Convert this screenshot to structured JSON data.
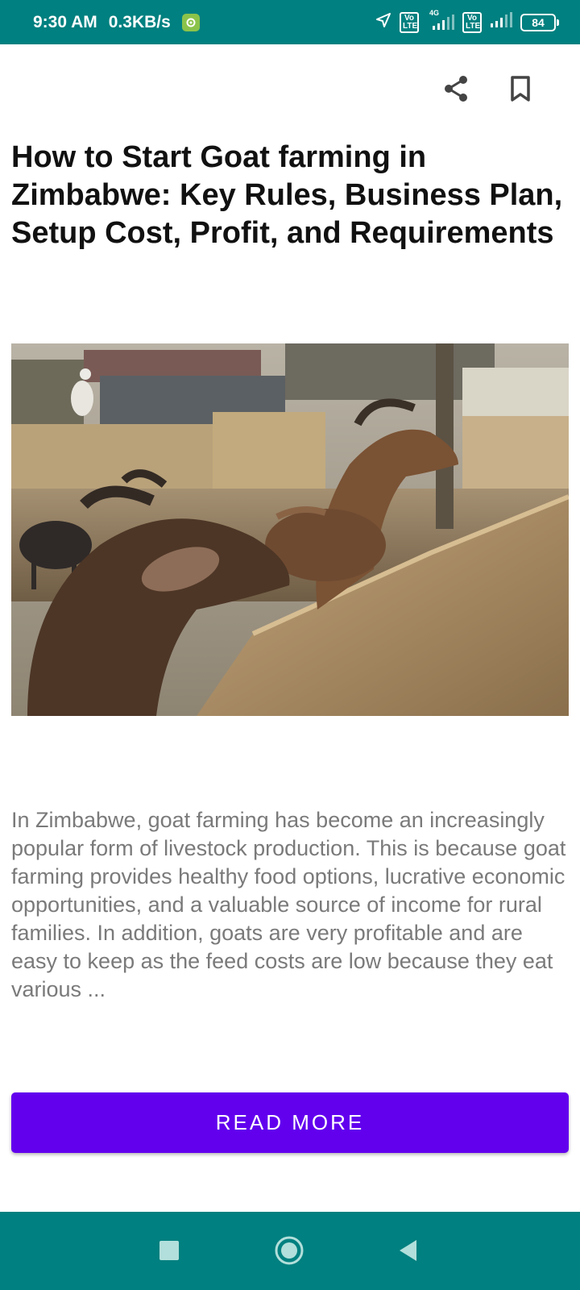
{
  "status_bar": {
    "time": "9:30 AM",
    "speed": "0.3KB/s",
    "volte1": "Vo LTE",
    "network": "4G",
    "volte2": "Vo LTE",
    "battery": "84"
  },
  "actions": {
    "share_icon": "share-icon",
    "bookmark_icon": "bookmark-icon"
  },
  "article": {
    "title": "How to Start Goat farming in Zimbabwe: Key Rules, Business Plan, Setup Cost, Profit, and Requirements",
    "image_subject": "goats-at-stone-wall",
    "excerpt": "In Zimbabwe, goat farming has become an increasingly popular form of livestock production. This is because goat farming provides healthy food options, lucrative economic opportunities, and a valuable source of income for rural families. In addition, goats are very profitable and are easy to keep as the feed costs are low because they eat various ...",
    "read_more_label": "READ MORE"
  },
  "colors": {
    "status_bar": "#008080",
    "nav_bar": "#008080",
    "accent": "#6200ee",
    "body_text": "#7a7a7a"
  }
}
